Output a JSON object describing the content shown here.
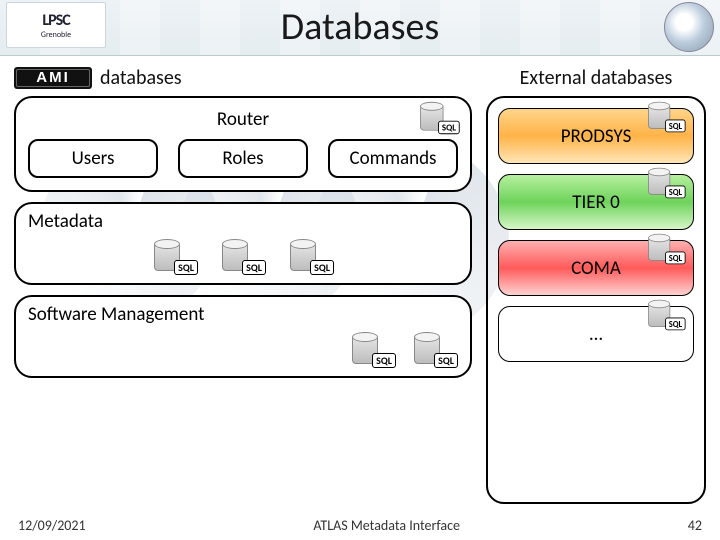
{
  "header": {
    "title": "Databases",
    "logo_left_top": "LPSC",
    "logo_left_sub": "Grenoble",
    "ami_text": "AMI"
  },
  "left": {
    "heading_suffix": "databases",
    "router_label": "Router",
    "nodes": [
      "Users",
      "Roles",
      "Commands"
    ],
    "metadata_label": "Metadata",
    "software_label": "Software Management",
    "sql_tag": "SQL"
  },
  "right": {
    "heading": "External databases",
    "items": [
      "PRODSYS",
      "TIER 0",
      "COMA",
      "…"
    ],
    "sql_tag": "SQL"
  },
  "footer": {
    "date": "12/09/2021",
    "center": "ATLAS Metadata Interface",
    "page": "42"
  }
}
